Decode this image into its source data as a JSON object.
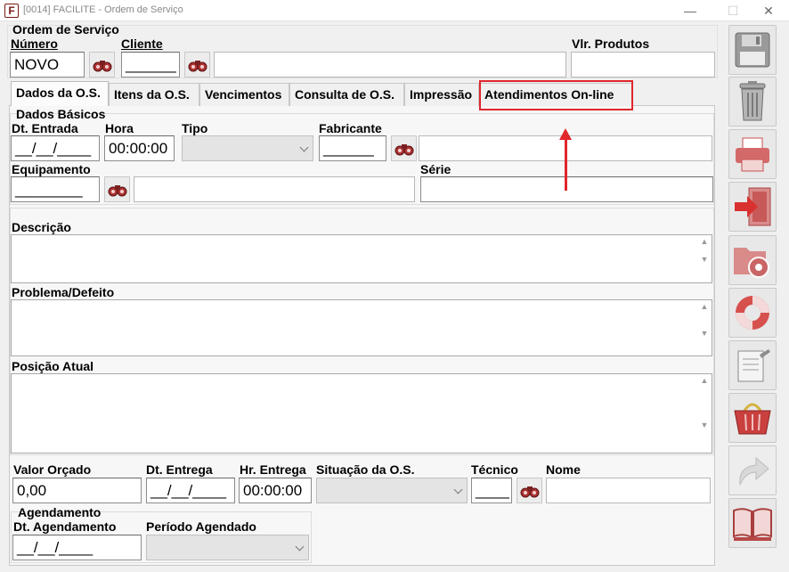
{
  "window": {
    "title": "[0014] FACILITE - Ordem de Serviço",
    "app_icon_letter": "F",
    "minimize": "—",
    "maximize": "☐",
    "close": "✕"
  },
  "header": {
    "group_title": "Ordem de Serviço",
    "numero_label": "Número",
    "numero_value": "NOVO",
    "cliente_label": "Cliente",
    "cliente_value": "______",
    "cliente_nome_value": "",
    "vlr_produtos_label": "Vlr. Produtos",
    "vlr_produtos_value": ""
  },
  "tabs": [
    {
      "label": "Dados da O.S.",
      "active": true
    },
    {
      "label": "Itens da O.S."
    },
    {
      "label": "Vencimentos"
    },
    {
      "label": "Consulta de O.S."
    },
    {
      "label": "Impressão"
    },
    {
      "label": "Atendimentos On-line"
    }
  ],
  "dados_basicos": {
    "title": "Dados Básicos",
    "dt_entrada_label": "Dt. Entrada",
    "dt_entrada_value": "__/__/____",
    "hora_label": "Hora",
    "hora_value": "00:00:00",
    "tipo_label": "Tipo",
    "tipo_value": "",
    "fabricante_label": "Fabricante",
    "fabricante_value": "______",
    "fabricante_nome_value": "",
    "equipamento_label": "Equipamento",
    "equipamento_value": "________",
    "equipamento_nome_value": "",
    "serie_label": "Série",
    "serie_value": ""
  },
  "descricao_label": "Descrição",
  "problema_label": "Problema/Defeito",
  "posicao_label": "Posição Atual",
  "footer": {
    "valor_orcado_label": "Valor Orçado",
    "valor_orcado_value": "0,00",
    "dt_entrega_label": "Dt. Entrega",
    "dt_entrega_value": "__/__/____",
    "hr_entrega_label": "Hr. Entrega",
    "hr_entrega_value": "00:00:00",
    "situacao_label": "Situação da O.S.",
    "situacao_value": "",
    "tecnico_label": "Técnico",
    "tecnico_value": "____",
    "nome_label": "Nome",
    "nome_value": ""
  },
  "agendamento": {
    "title": "Agendamento",
    "dt_agendamento_label": "Dt. Agendamento",
    "dt_agendamento_value": "__/__/____",
    "periodo_label": "Período Agendado",
    "periodo_value": ""
  },
  "toolbar_icons": [
    "save-icon",
    "trash-icon",
    "printer-icon",
    "exit-door-icon",
    "folder-settings-icon",
    "lifebuoy-icon",
    "notepad-icon",
    "basket-icon",
    "redo-arrow-icon",
    "open-book-icon"
  ],
  "colors": {
    "highlight": "#e0262b",
    "toolbar_icon_red": "#c7504f"
  }
}
